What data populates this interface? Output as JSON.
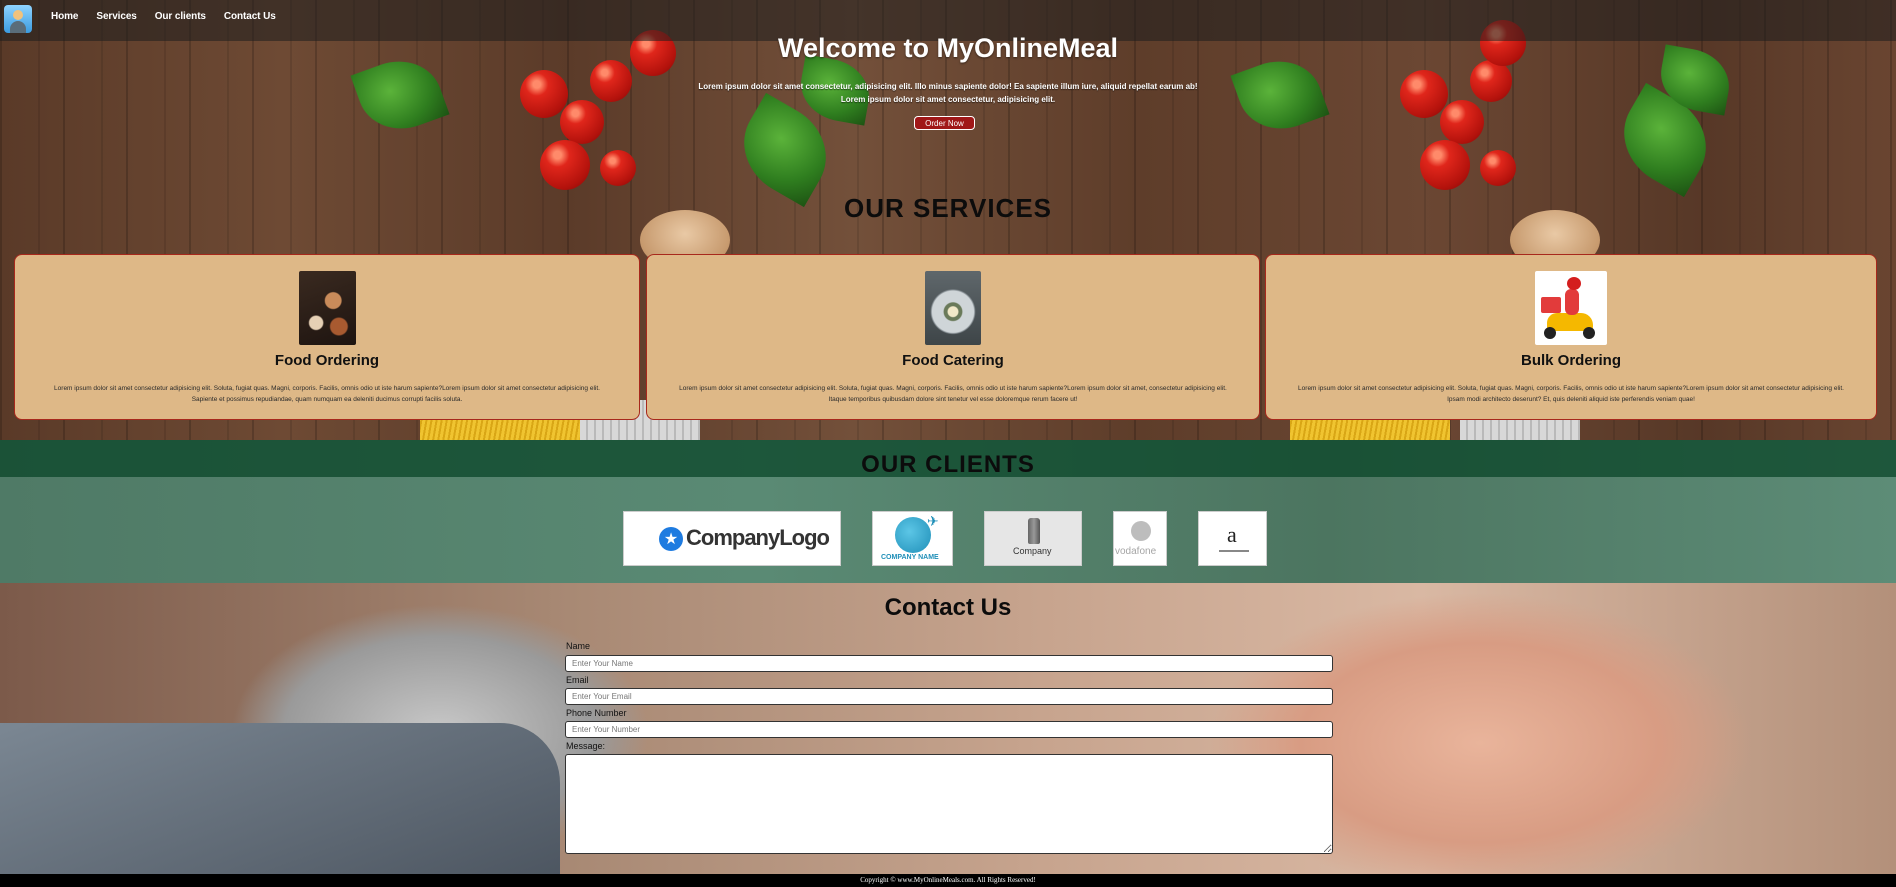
{
  "nav": {
    "links": [
      "Home",
      "Services",
      "Our clients",
      "Contact Us"
    ]
  },
  "hero": {
    "title": "Welcome to MyOnlineMeal",
    "text": "Lorem ipsum dolor sit amet consectetur, adipisicing elit. Illo minus sapiente dolor! Ea sapiente illum iure, aliquid repellat earum ab! Lorem ipsum dolor sit amet consectetur, adipisicing elit.",
    "button": "Order Now"
  },
  "services": {
    "heading": "OUR SERVICES",
    "items": [
      {
        "title": "Food Ordering",
        "text": "Lorem ipsum dolor sit amet consectetur adipisicing elit. Soluta, fugiat quas. Magni, corporis. Facilis, omnis odio ut iste harum sapiente?Lorem ipsum dolor sit amet consectetur adipisicing elit. Sapiente et possimus repudiandae, quam numquam ea deleniti ducimus corrupti facilis soluta."
      },
      {
        "title": "Food Catering",
        "text": "Lorem ipsum dolor sit amet consectetur adipisicing elit. Soluta, fugiat quas. Magni, corporis. Facilis, omnis odio ut iste harum sapiente?Lorem ipsum dolor sit amet, consectetur adipisicing elit. Itaque temporibus quibusdam dolore sint tenetur vel esse doloremque rerum facere ut!"
      },
      {
        "title": "Bulk Ordering",
        "text": "Lorem ipsum dolor sit amet consectetur adipisicing elit. Soluta, fugiat quas. Magni, corporis. Facilis, omnis odio ut iste harum sapiente?Lorem ipsum dolor sit amet consectetur adipisicing elit. Ipsam modi architecto deserunt? Et, quis deleniti aliquid iste perferendis veniam quae!"
      }
    ]
  },
  "clients": {
    "heading": "OUR CLIENTS",
    "logos": {
      "logo1": "CompanyLogo",
      "logo2": "COMPANY NAME",
      "logo3": "Company",
      "logo4": "vodafone",
      "logo5": "a"
    }
  },
  "contact": {
    "heading": "Contact Us",
    "name_label": "Name",
    "name_placeholder": "Enter Your Name",
    "email_label": "Email",
    "email_placeholder": "Enter Your Email",
    "phone_label": "Phone Number",
    "phone_placeholder": "Enter Your Number",
    "message_label": "Message:"
  },
  "footer": {
    "text": "Copyright © www.MyOnlineMeals.com. All Rights Reserved!"
  },
  "colors": {
    "card_bg": "#deb887",
    "card_border": "#a7281c",
    "order_button": "#a01818",
    "footer_bg": "#000000"
  }
}
